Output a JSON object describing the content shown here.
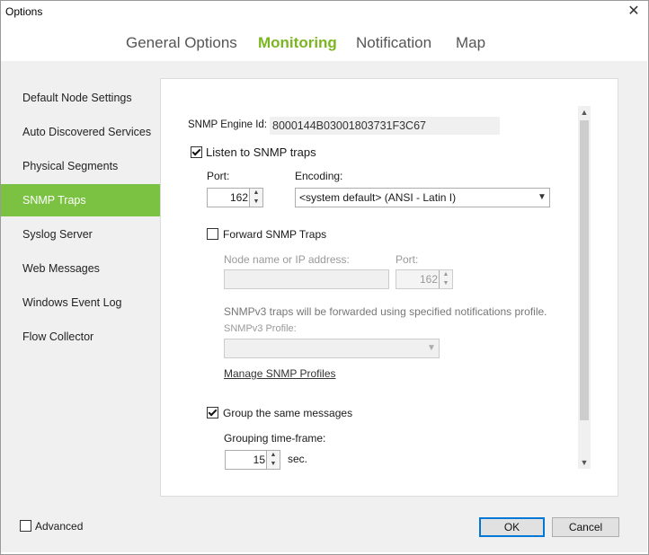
{
  "window": {
    "title": "Options",
    "close_glyph": "✕"
  },
  "tabs": [
    {
      "label": "General Options"
    },
    {
      "label": "Monitoring"
    },
    {
      "label": "Notification"
    },
    {
      "label": "Map"
    }
  ],
  "sidebar": {
    "items": [
      {
        "label": "Default Node Settings"
      },
      {
        "label": "Auto Discovered Services"
      },
      {
        "label": "Physical Segments"
      },
      {
        "label": "SNMP Traps"
      },
      {
        "label": "Syslog Server"
      },
      {
        "label": "Web Messages"
      },
      {
        "label": "Windows Event Log"
      },
      {
        "label": "Flow Collector"
      }
    ],
    "active_index": 3
  },
  "snmp": {
    "engine_id_label": "SNMP Engine Id:",
    "engine_id_value": "8000144B03001803731F3C67",
    "listen_label": "Listen to SNMP traps",
    "listen_checked": true,
    "port_label": "Port:",
    "port_value": "162",
    "encoding_label": "Encoding:",
    "encoding_value": "<system default> (ANSI - Latin I)",
    "forward_label": "Forward SNMP Traps",
    "forward_checked": false,
    "node_label": "Node name or IP address:",
    "fwd_port_label": "Port:",
    "fwd_port_value": "162",
    "snmpv3_note": "SNMPv3 traps will be forwarded using specified notifications profile.",
    "snmpv3_profile_label": "SNMPv3 Profile:",
    "manage_link": "Manage SNMP Profiles",
    "group_label": "Group the same messages",
    "group_checked": true,
    "timeframe_label": "Grouping time-frame:",
    "timeframe_value": "15",
    "timeframe_unit": "sec."
  },
  "footer": {
    "advanced_label": "Advanced",
    "advanced_checked": false,
    "ok_label": "OK",
    "cancel_label": "Cancel"
  },
  "icons": {
    "close": "close-icon",
    "dropdown": "chevron-down-icon",
    "spin_up": "chevron-up-icon",
    "scroll_up": "chevron-up-icon",
    "scroll_down": "chevron-down-icon"
  },
  "colors": {
    "accent": "#7bc142",
    "tab_active": "#7bb622"
  }
}
